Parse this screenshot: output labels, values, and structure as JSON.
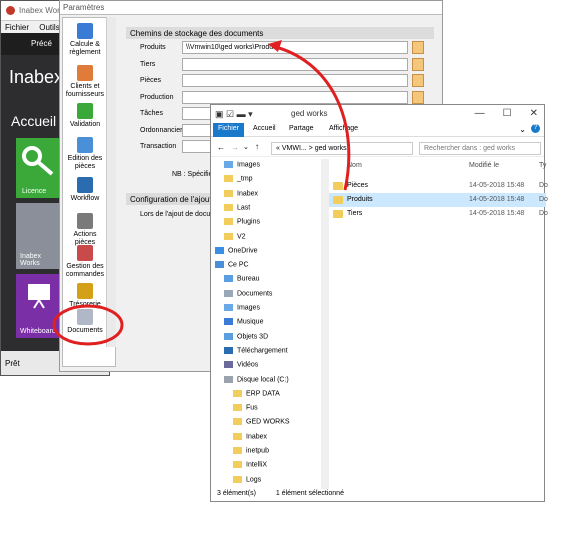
{
  "bgapp": {
    "title": "Inabex Works",
    "menu": [
      "Fichier",
      "Outils"
    ],
    "toolbar_label": "Précé",
    "app_name": "Inabex",
    "home": "Accueil",
    "tiles": [
      "Licence",
      "Inabex Works",
      "Whiteboard"
    ],
    "status": "Prêt"
  },
  "params": {
    "title": "Paramètres",
    "sidebar": [
      {
        "label": "Calcule & règlement",
        "icon": "calculator-icon",
        "color": "#3a7bd5"
      },
      {
        "label": "Clients et fournisseurs",
        "icon": "users-icon",
        "color": "#e07b39"
      },
      {
        "label": "Validation",
        "icon": "checkmark-icon",
        "color": "#3aa93a"
      },
      {
        "label": "Edition des pièces",
        "icon": "edit-icon",
        "color": "#4a90d9"
      },
      {
        "label": "Workflow",
        "icon": "workflow-icon",
        "color": "#2b6cb0"
      },
      {
        "label": "Actions pièces",
        "icon": "gears-icon",
        "color": "#7a7a7a"
      },
      {
        "label": "Gestion des commandes",
        "icon": "cart-icon",
        "color": "#c94a4a"
      },
      {
        "label": "Trésorerie",
        "icon": "coins-icon",
        "color": "#d4a017"
      },
      {
        "label": "Documents",
        "icon": "documents-icon",
        "color": "#b0b8c8"
      }
    ],
    "group_storage": "Chemins de stockage des documents",
    "fields": [
      {
        "label": "Produits",
        "value": "\\\\Vmwin10\\ged works\\Produits"
      },
      {
        "label": "Tiers",
        "value": ""
      },
      {
        "label": "Pièces",
        "value": ""
      },
      {
        "label": "Production",
        "value": ""
      },
      {
        "label": "Tâches",
        "value": ""
      },
      {
        "label": "Ordonnancier",
        "value": ""
      },
      {
        "label": "Transaction",
        "value": ""
      }
    ],
    "note": "NB : Spécifie",
    "group_add": "Configuration de l'ajout d",
    "add_label": "Lors de l'ajout de docume"
  },
  "explorer": {
    "title": "ged works",
    "tabs": [
      "Fichier",
      "Accueil",
      "Partage",
      "Affichage"
    ],
    "address": "« VMWI... > ged works",
    "search_placeholder": "Rechercher dans : ged works",
    "nav": [
      {
        "label": "Images",
        "type": "images",
        "indent": 1
      },
      {
        "label": "_tmp",
        "type": "folder",
        "indent": 1
      },
      {
        "label": "Inabex",
        "type": "folder",
        "indent": 1
      },
      {
        "label": "Last",
        "type": "folder",
        "indent": 1
      },
      {
        "label": "Plugins",
        "type": "folder",
        "indent": 1
      },
      {
        "label": "V2",
        "type": "folder",
        "indent": 1
      },
      {
        "label": "OneDrive",
        "type": "cloud",
        "indent": 0
      },
      {
        "label": "Ce PC",
        "type": "pc",
        "indent": 0
      },
      {
        "label": "Bureau",
        "type": "desktop",
        "indent": 1
      },
      {
        "label": "Documents",
        "type": "doc",
        "indent": 1
      },
      {
        "label": "Images",
        "type": "images",
        "indent": 1
      },
      {
        "label": "Musique",
        "type": "music",
        "indent": 1
      },
      {
        "label": "Objets 3D",
        "type": "cube",
        "indent": 1
      },
      {
        "label": "Téléchargement",
        "type": "download",
        "indent": 1
      },
      {
        "label": "Vidéos",
        "type": "video",
        "indent": 1
      },
      {
        "label": "Disque local (C:)",
        "type": "disk",
        "indent": 1
      },
      {
        "label": "ERP DATA",
        "type": "folder",
        "indent": 2
      },
      {
        "label": "Fus",
        "type": "folder",
        "indent": 2
      },
      {
        "label": "GED WORKS",
        "type": "folder",
        "indent": 2
      },
      {
        "label": "Inabex",
        "type": "folder",
        "indent": 2
      },
      {
        "label": "inetpub",
        "type": "folder",
        "indent": 2
      },
      {
        "label": "IntelliX",
        "type": "folder",
        "indent": 2
      },
      {
        "label": "Logs",
        "type": "folder",
        "indent": 2
      }
    ],
    "columns": {
      "name": "Nom",
      "date": "Modifié le",
      "type": "Ty"
    },
    "rows": [
      {
        "name": "Pièces",
        "date": "14-05-2018 15:48",
        "type": "Do",
        "selected": false
      },
      {
        "name": "Produits",
        "date": "14-05-2018 15:48",
        "type": "Do",
        "selected": true
      },
      {
        "name": "Tiers",
        "date": "14-05-2018 15:48",
        "type": "Do",
        "selected": false
      }
    ],
    "status_count": "3 élément(s)",
    "status_selected": "1 élément sélectionné"
  },
  "colors": {
    "accent": "#1979ca",
    "annotation": "#e02020",
    "folder": "#f3cd5b"
  }
}
